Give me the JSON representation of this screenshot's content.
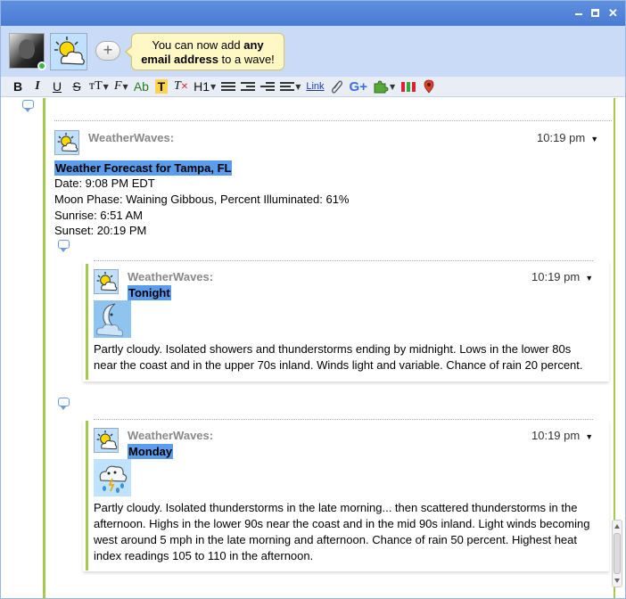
{
  "window": {
    "controls": [
      "minimize",
      "maximize",
      "close"
    ]
  },
  "header": {
    "tip": {
      "part1": "You can now add ",
      "bold1": "any",
      "bold2": "email address",
      "part2": " to a wave!"
    },
    "add_label": "+"
  },
  "toolbar": {
    "bold": "B",
    "italic": "I",
    "underline": "U",
    "strike": "S",
    "font_size": "тT",
    "font_family": "F",
    "text_color": "Ab",
    "highlight": "T",
    "clear_format": "T",
    "heading": "H1",
    "link": "Link",
    "gplus": "G+"
  },
  "root_blip": {
    "author": "WeatherWaves:",
    "time": "10:19 pm",
    "title": "Weather Forecast for Tampa, FL",
    "lines": [
      "Date: 9:08 PM EDT",
      "Moon Phase: Waining Gibbous, Percent Illuminated: 61%",
      "Sunrise: 6:51 AM",
      "Sunset: 20:19 PM"
    ]
  },
  "replies": [
    {
      "author": "WeatherWaves:",
      "time": "10:19 pm",
      "title": "Tonight",
      "icon": "partly-cloudy-night-icon",
      "text": "Partly cloudy. Isolated showers and thunderstorms ending by midnight. Lows in the lower 80s near the coast and in the upper 70s inland. Winds light and variable. Chance of rain 20 percent."
    },
    {
      "author": "WeatherWaves:",
      "time": "10:19 pm",
      "title": "Monday",
      "icon": "thunderstorm-icon",
      "text": "Partly cloudy. Isolated thunderstorms in the late morning... then scattered thunderstorms in the afternoon. Highs in the lower 90s near the coast and in the mid 90s inland. Light winds becoming west around 5 mph in the late morning and afternoon. Chance of rain 50 percent. Highest heat index readings 105 to 110 in the afternoon."
    }
  ],
  "colors": {
    "accent_green": "#a8c84a",
    "highlight_blue": "#5b9ced",
    "header_bg": "#c9dbf7",
    "tip_bg": "#fff8c4"
  }
}
